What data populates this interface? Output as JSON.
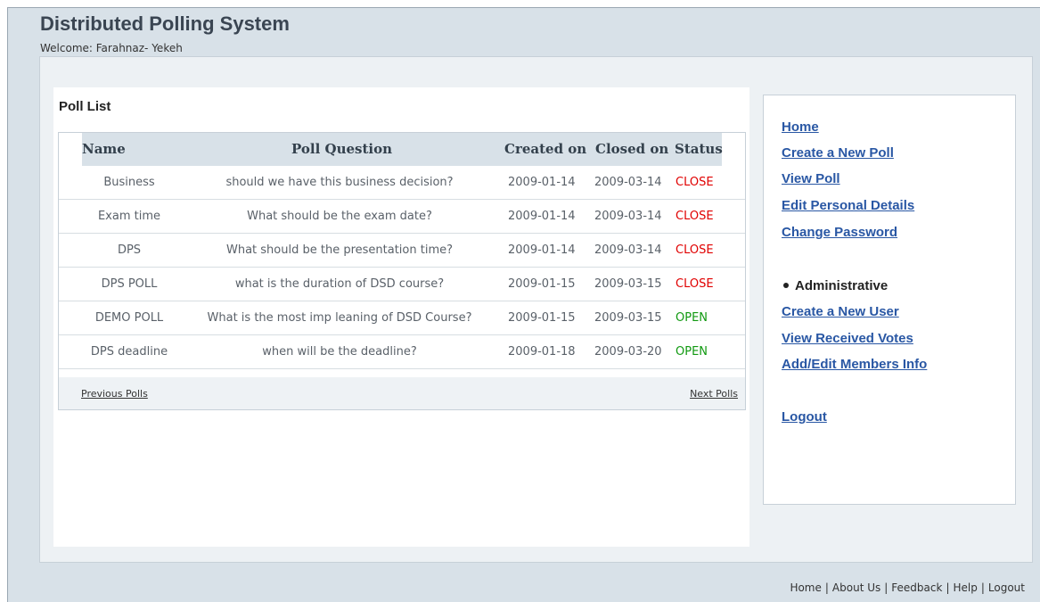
{
  "app": {
    "title": "Distributed Polling System",
    "welcome": "Welcome: Farahnaz- Yekeh"
  },
  "poll_list": {
    "title": "Poll List",
    "columns": {
      "name": "Name",
      "question": "Poll Question",
      "created": "Created on",
      "closed": "Closed on",
      "status": "Status"
    },
    "rows": [
      {
        "name": "Business",
        "question": "should we have this business decision?",
        "created": "2009-01-14",
        "closed": "2009-03-14",
        "status": "CLOSE"
      },
      {
        "name": "Exam time",
        "question": "What should be the exam date?",
        "created": "2009-01-14",
        "closed": "2009-03-14",
        "status": "CLOSE"
      },
      {
        "name": "DPS",
        "question": "What should be the presentation time?",
        "created": "2009-01-14",
        "closed": "2009-03-14",
        "status": "CLOSE"
      },
      {
        "name": "DPS POLL",
        "question": "what is the duration of DSD course?",
        "created": "2009-01-15",
        "closed": "2009-03-15",
        "status": "CLOSE"
      },
      {
        "name": "DEMO POLL",
        "question": "What is the most imp leaning of DSD Course?",
        "created": "2009-01-15",
        "closed": "2009-03-15",
        "status": "OPEN"
      },
      {
        "name": "DPS deadline",
        "question": "when will be the deadline?",
        "created": "2009-01-18",
        "closed": "2009-03-20",
        "status": "OPEN"
      }
    ],
    "previous_label": "Previous Polls",
    "next_label": "Next Polls"
  },
  "sidebar": {
    "links": {
      "home": "Home",
      "create_poll": "Create a New Poll",
      "view_poll": "View Poll",
      "edit_details": "Edit Personal Details",
      "change_password": "Change Password"
    },
    "admin_label": "Administrative",
    "admin_links": {
      "create_user": "Create a New User",
      "view_votes": "View Received Votes",
      "edit_members": "Add/Edit Members Info"
    },
    "logout": "Logout"
  },
  "footer": {
    "home": "Home",
    "about": "About Us",
    "feedback": "Feedback",
    "help": "Help",
    "logout": "Logout",
    "separator": "|"
  },
  "colors": {
    "status_close": "#e00000",
    "status_open": "#119911",
    "link": "#2957a4"
  }
}
